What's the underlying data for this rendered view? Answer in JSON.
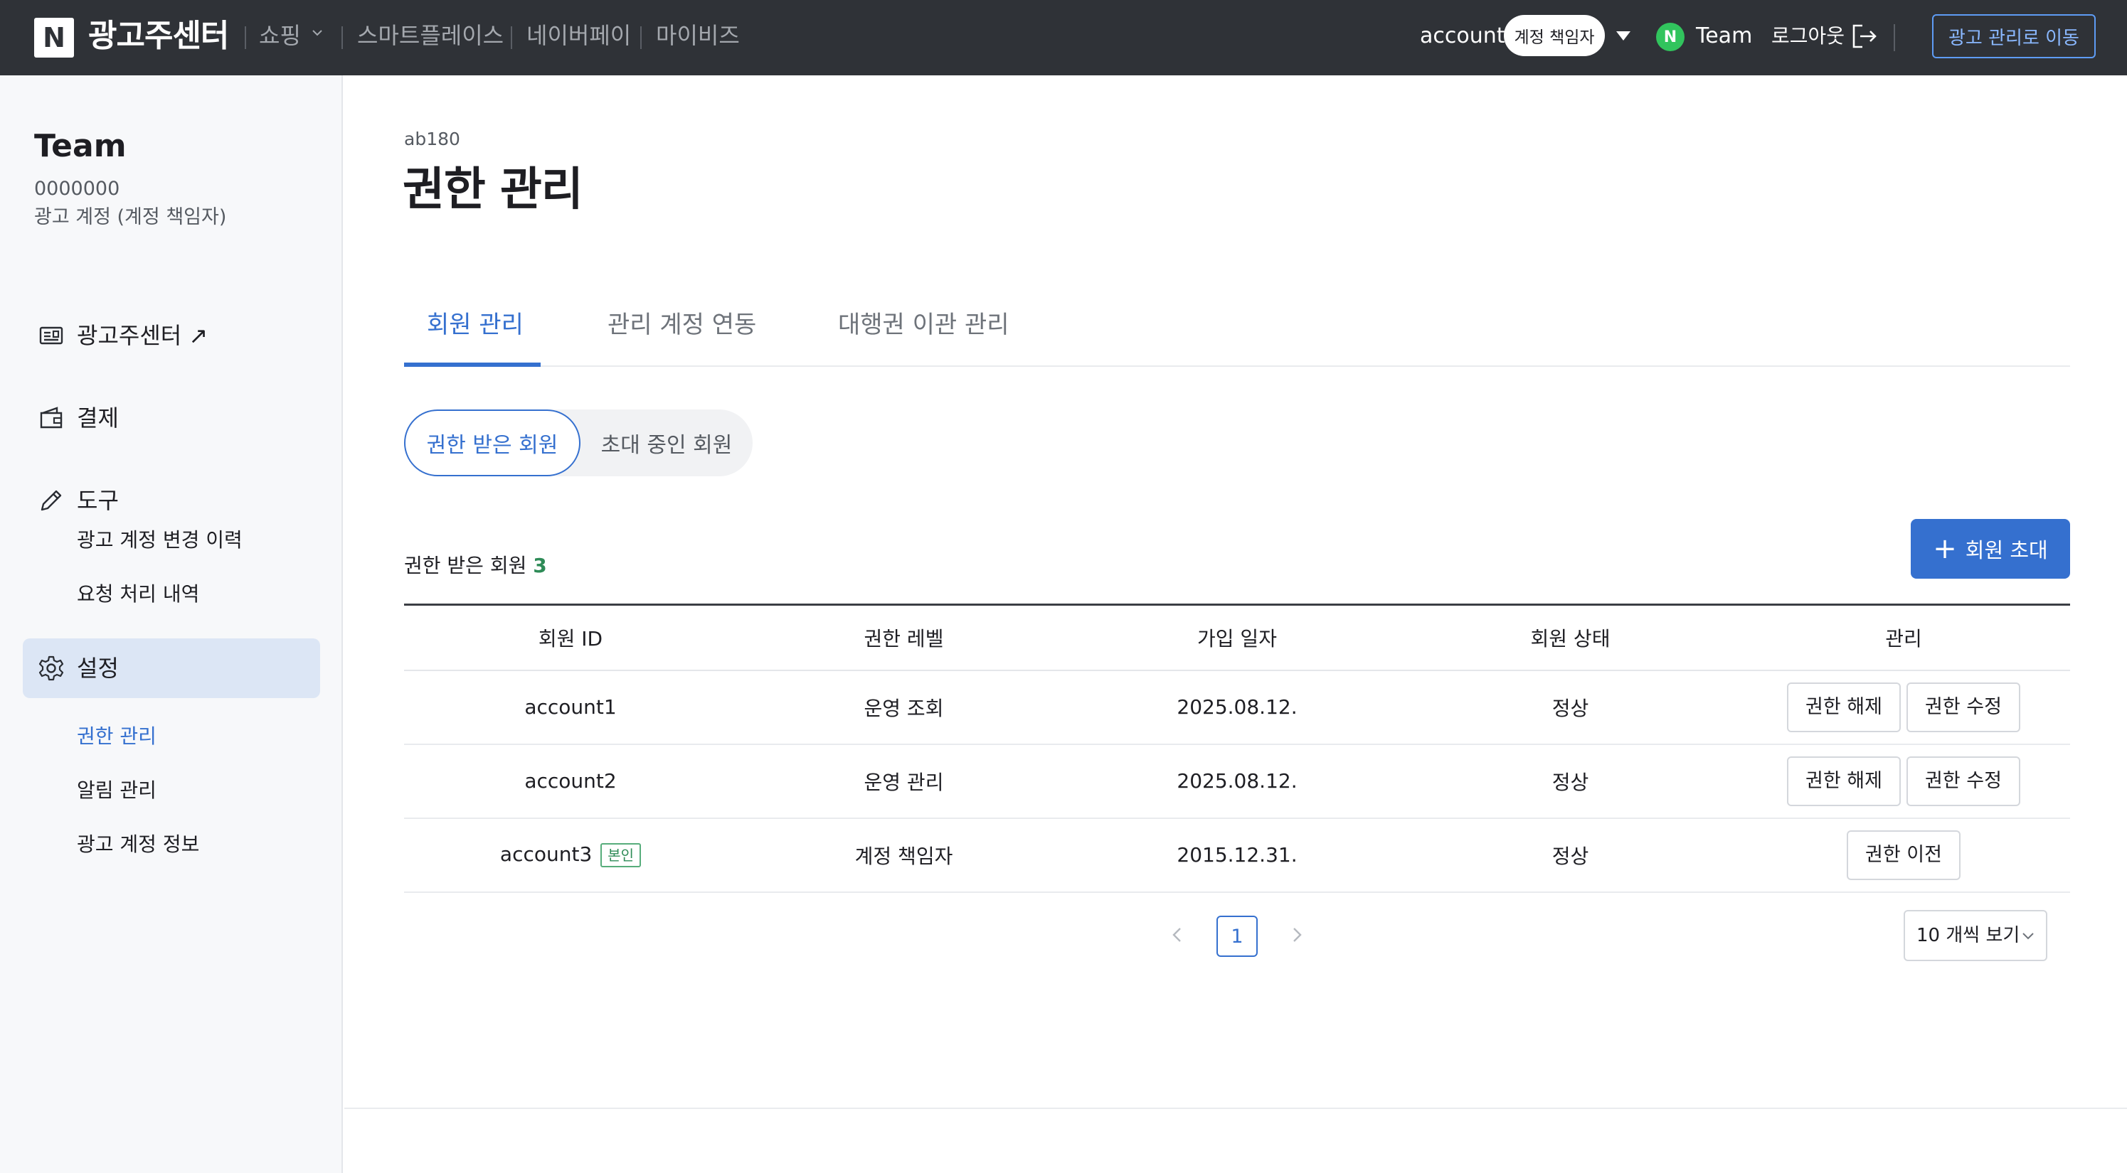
{
  "header": {
    "logo_letter": "N",
    "brand": "광고주센터",
    "nav": [
      "쇼핑",
      "스마트플레이스",
      "네이버페이",
      "마이비즈"
    ],
    "account_label": "account",
    "role_badge": "계정 책임자",
    "team_initial": "N",
    "team_name": "Team",
    "logout_label": "로그아웃",
    "move_button": "광고 관리로 이동"
  },
  "sidebar": {
    "team_name": "Team",
    "account_id": "0000000",
    "account_type": "광고 계정 (계정 책임자)",
    "items": [
      {
        "label": "광고주센터 ↗",
        "icon": "ad-center-icon"
      },
      {
        "label": "결제",
        "icon": "wallet-icon"
      },
      {
        "label": "도구",
        "icon": "pencil-icon"
      },
      {
        "label": "설정",
        "icon": "gear-icon"
      }
    ],
    "tools_sub": [
      "광고 계정 변경 이력",
      "요청 처리 내역"
    ],
    "settings_sub": [
      "권한 관리",
      "알림 관리",
      "광고 계정 정보"
    ]
  },
  "main": {
    "breadcrumb": "ab180",
    "title": "권한 관리",
    "tabs": [
      "회원 관리",
      "관리 계정 연동",
      "대행권 이관 관리"
    ],
    "segments": [
      "권한 받은 회원",
      "초대 중인 회원"
    ],
    "count_label": "권한 받은 회원",
    "count_value": "3",
    "invite_button": "회원 초대",
    "table": {
      "columns": [
        "회원 ID",
        "권한 레벨",
        "가입 일자",
        "회원 상태",
        "관리"
      ],
      "rows": [
        {
          "id": "account1",
          "level": "운영 조회",
          "date": "2025.08.12.",
          "status": "정상",
          "actions": [
            "권한 해제",
            "권한 수정"
          ]
        },
        {
          "id": "account2",
          "level": "운영 관리",
          "date": "2025.08.12.",
          "status": "정상",
          "actions": [
            "권한 해제",
            "권한 수정"
          ]
        },
        {
          "id": "account3",
          "self_tag": "본인",
          "level": "계정 책임자",
          "date": "2015.12.31.",
          "status": "정상",
          "actions": [
            "권한 이전"
          ]
        }
      ]
    },
    "pagination": {
      "current_page": "1",
      "per_page": "10 개씩 보기"
    }
  },
  "colors": {
    "topbar": "#2f3237",
    "accent": "#3570cf",
    "count_green": "#2e8b57",
    "sidebar_bg": "#f7f8fa",
    "active_item_bg": "#dce6f5"
  }
}
